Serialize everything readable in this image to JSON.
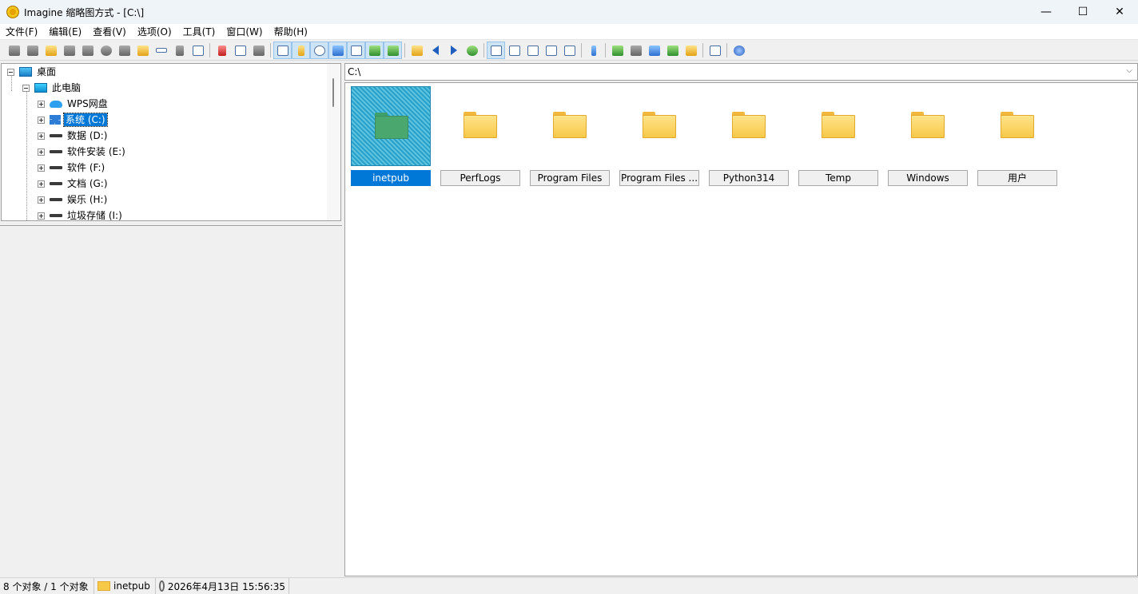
{
  "window": {
    "title": "Imagine 缩略图方式 - [C:\\]",
    "icon": "imagine-app-icon",
    "controls": {
      "minimize": "—",
      "maximize": "☐",
      "close": "✕"
    }
  },
  "menu": [
    "文件(F)",
    "编辑(E)",
    "查看(V)",
    "选项(O)",
    "工具(T)",
    "窗口(W)",
    "帮助(H)"
  ],
  "toolbar": [
    "view-icon",
    "browse-icon",
    "open-icon",
    "save-icon",
    "print-icon",
    "info-icon",
    "capture-icon",
    "new-folder-icon",
    "rename-icon",
    "delete-icon",
    "properties-icon",
    "cut-icon",
    "copy-icon",
    "paste-icon",
    "window-view-icon",
    "tree-view-icon",
    "cd-icon",
    "thumbnail-icon",
    "grid-icon",
    "preview-icon",
    "slideshow-icon",
    "up-folder-icon",
    "back-icon",
    "forward-icon",
    "refresh-icon",
    "large-icons-icon",
    "small-icons-icon",
    "list-icon",
    "details-icon",
    "table-icon",
    "settings-icon",
    "convert-icon",
    "batch-icon",
    "screen-capture-icon",
    "film-icon",
    "edit-icon",
    "plugin-icon",
    "help-icon"
  ],
  "tree": {
    "root": "桌面",
    "pc": "此电脑",
    "items": [
      {
        "label": "WPS网盘",
        "icon": "cloud-icon"
      },
      {
        "label": "系统 (C:)",
        "icon": "windows-drive-icon",
        "selected": true
      },
      {
        "label": "数据 (D:)",
        "icon": "drive-icon"
      },
      {
        "label": "软件安装 (E:)",
        "icon": "drive-icon"
      },
      {
        "label": "软件 (F:)",
        "icon": "drive-icon"
      },
      {
        "label": "文档 (G:)",
        "icon": "drive-icon"
      },
      {
        "label": "娱乐 (H:)",
        "icon": "drive-icon"
      },
      {
        "label": "垃圾存储 (I:)",
        "icon": "drive-icon"
      }
    ]
  },
  "address": {
    "value": "C:\\"
  },
  "thumbnails": [
    {
      "label": "inetpub",
      "selected": true
    },
    {
      "label": "PerfLogs"
    },
    {
      "label": "Program Files"
    },
    {
      "label": "Program Files ..."
    },
    {
      "label": "Python314"
    },
    {
      "label": "Temp"
    },
    {
      "label": "Windows"
    },
    {
      "label": "用户"
    }
  ],
  "status": {
    "objects": "8 个对象 / 1 个对象",
    "selected_name": "inetpub",
    "modified": "2026年4月13日 15:56:35"
  },
  "colors": {
    "selection": "#0078d7",
    "folder": "#f7c948",
    "titlebar": "#eff4f9"
  }
}
